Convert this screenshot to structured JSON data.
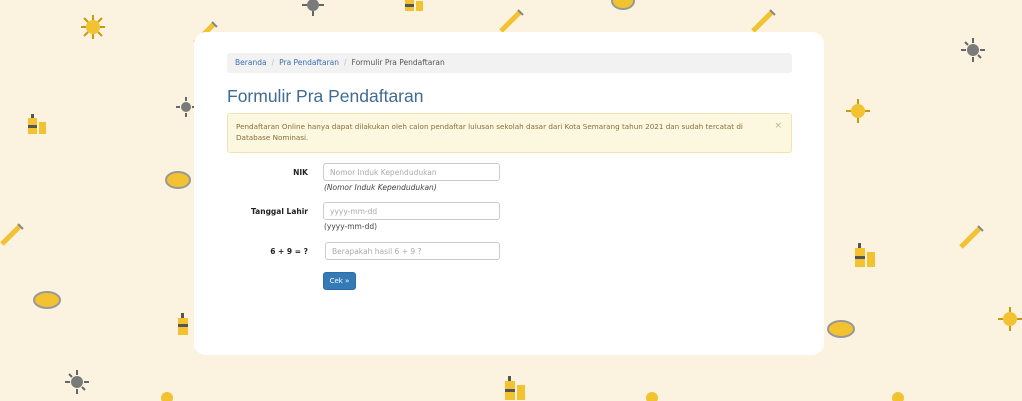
{
  "breadcrumb": {
    "items": [
      "Beranda",
      "Pra Pendaftaran",
      "Formulir Pra Pendaftaran"
    ]
  },
  "page": {
    "title": "Formulir Pra Pendaftaran"
  },
  "alert": {
    "message": "Pendaftaran Online hanya dapat dilakukan oleh calon pendaftar lulusan sekolah dasar dari Kota Semarang tahun 2021 dan sudah tercatat di Database Nominasi.",
    "close": "×"
  },
  "form": {
    "nik": {
      "label": "NIK",
      "placeholder": "Nomor Induk Kependudukan",
      "help": "(Nomor Induk Kependudukan)"
    },
    "birthdate": {
      "label": "Tanggal Lahir",
      "placeholder": "yyyy-mm-dd",
      "help": "(yyyy-mm-dd)"
    },
    "captcha": {
      "label": "6 + 9 = ?",
      "placeholder": "Berapakah hasil 6 + 9 ?"
    },
    "submit": "Cek »"
  },
  "colors": {
    "background": "#fbf3df",
    "accent": "#337ab7",
    "title": "#3f6b94",
    "alert_bg": "#fcf7df"
  },
  "decorations": [
    "virus-icon",
    "syringe-icon",
    "mask-icon",
    "sanitizer-icon"
  ]
}
